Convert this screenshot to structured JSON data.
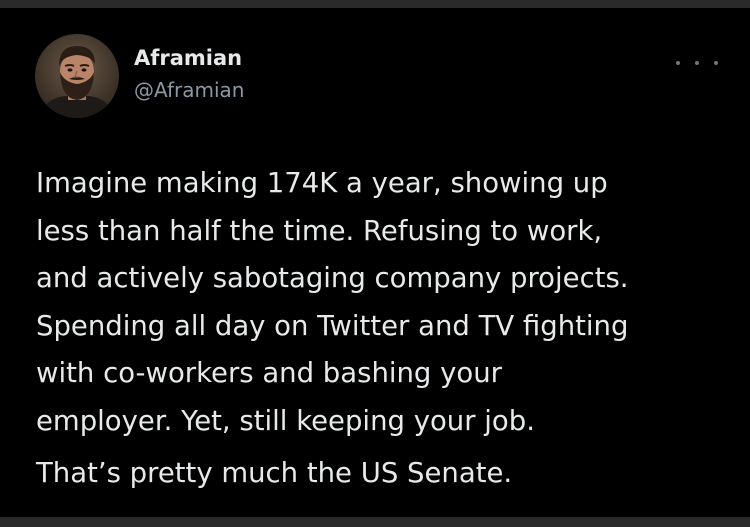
{
  "tweet": {
    "author": {
      "display_name": "Aframian",
      "handle": "@Aframian",
      "avatar_icon": "bearded-man-avatar"
    },
    "more_icon": "more-dots-icon",
    "body": {
      "lines": [
        "Imagine making 174K a year, showing up",
        "less than half the time. Refusing to work,",
        "and actively sabotaging company projects.",
        "Spending all day on Twitter and TV fighting",
        "with co-workers and bashing your",
        "employer. Yet, still keeping your job."
      ],
      "closing": "That’s pretty much the US Senate."
    }
  },
  "colors": {
    "background": "#000000",
    "text": "#e7e9ea",
    "secondary_text": "#8b98a5"
  }
}
